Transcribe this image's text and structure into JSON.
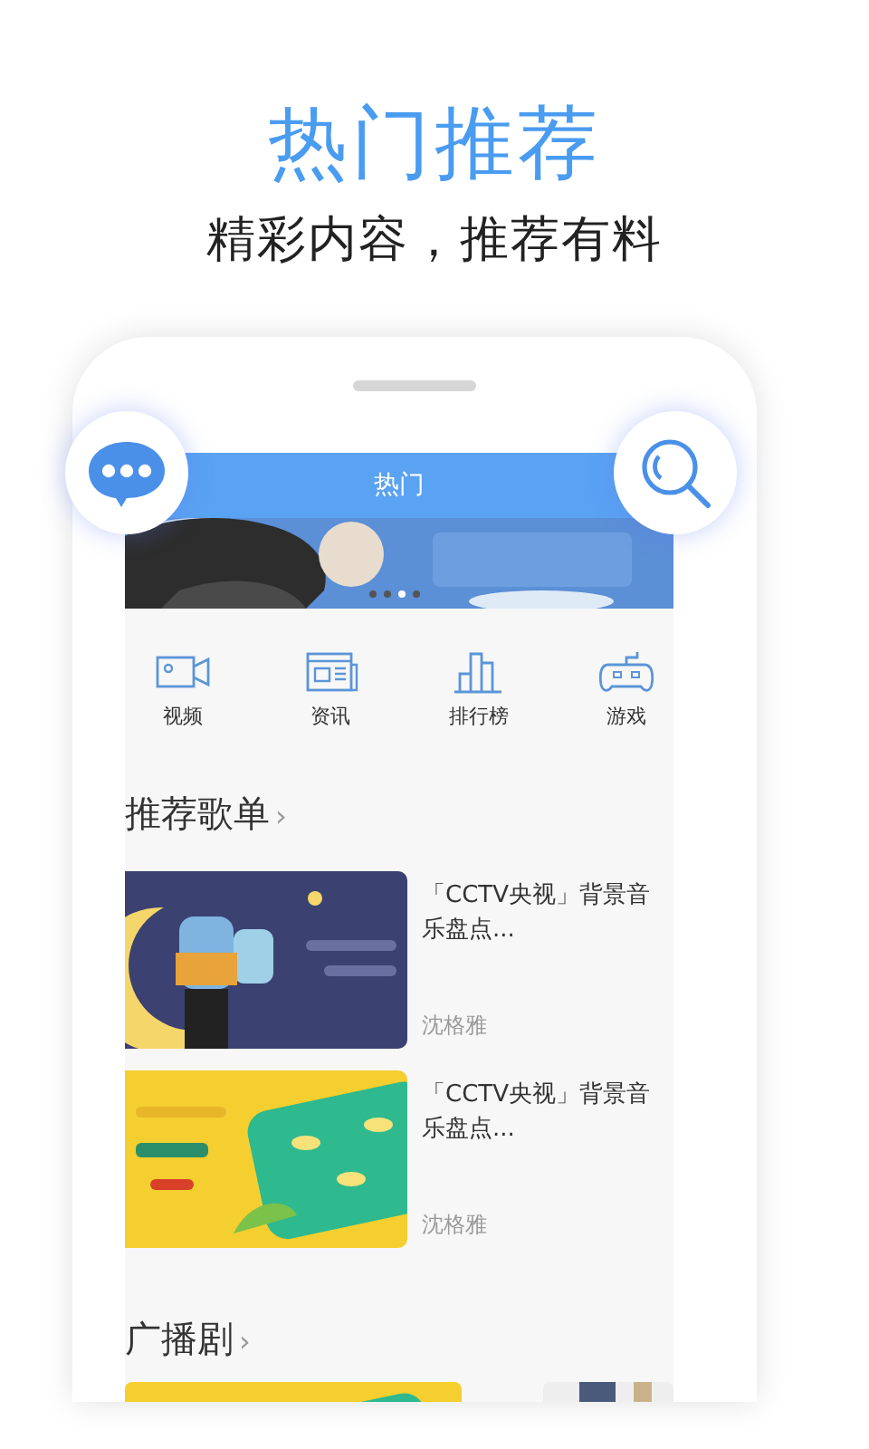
{
  "header": {
    "title": "热门推荐",
    "subtitle": "精彩内容，推荐有料"
  },
  "floating_buttons": [
    {
      "kind": "chat"
    },
    {
      "kind": "search"
    }
  ],
  "app": {
    "title": "热门",
    "banner": {
      "kind": "picture",
      "dots": [
        {
          "selected": false
        },
        {
          "selected": false
        },
        {
          "selected": true
        },
        {
          "selected": false
        }
      ]
    },
    "categories": [
      {
        "label": "视频",
        "kind": "video"
      },
      {
        "label": "资讯",
        "kind": "news"
      },
      {
        "label": "排行榜",
        "kind": "chart"
      },
      {
        "label": "游戏",
        "kind": "game"
      }
    ],
    "sections": [
      {
        "title": "推荐歌单",
        "more": "›",
        "items": [
          {
            "kind": "picture",
            "title": "「CCTV央视」背景音乐盘点...",
            "author": "沈格雅"
          },
          {
            "kind": "picture",
            "title": "「CCTV央视」背景音乐盘点...",
            "author": "沈格雅"
          }
        ]
      },
      {
        "title": "广播剧",
        "more": "›"
      }
    ]
  }
}
